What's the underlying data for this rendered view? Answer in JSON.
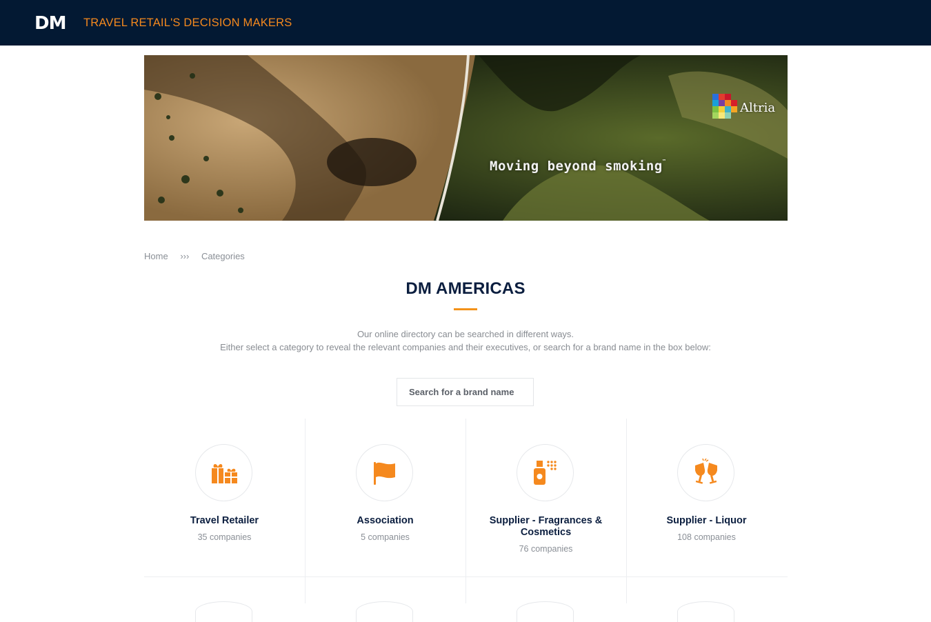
{
  "header": {
    "logo": "DM",
    "tagline": "TRAVEL RETAIL'S DECISION MAKERS"
  },
  "banner": {
    "slogan": "Moving beyond smoking",
    "trademark": "™",
    "brand": "Altria"
  },
  "breadcrumb": {
    "home": "Home",
    "separator": "›››",
    "current": "Categories"
  },
  "page": {
    "title": "DM AMERICAS",
    "intro_line1": "Our online directory can be searched in different ways.",
    "intro_line2": "Either select a category to reveal the relevant companies and their executives, or search for a brand name in the box below:"
  },
  "search": {
    "placeholder": "Search for a brand name"
  },
  "categories": [
    {
      "name": "Travel Retailer",
      "count": "35 companies",
      "icon": "gifts-icon"
    },
    {
      "name": "Association",
      "count": "5 companies",
      "icon": "flag-icon"
    },
    {
      "name": "Supplier - Fragrances & Cosmetics",
      "count": "76 companies",
      "icon": "spray-bottle-icon"
    },
    {
      "name": "Supplier - Liquor",
      "count": "108 companies",
      "icon": "glasses-cheers-icon"
    }
  ],
  "colors": {
    "topbar": "#031933",
    "accent": "#f5891e",
    "title": "#0b1e3f",
    "muted": "#8a8f96"
  }
}
